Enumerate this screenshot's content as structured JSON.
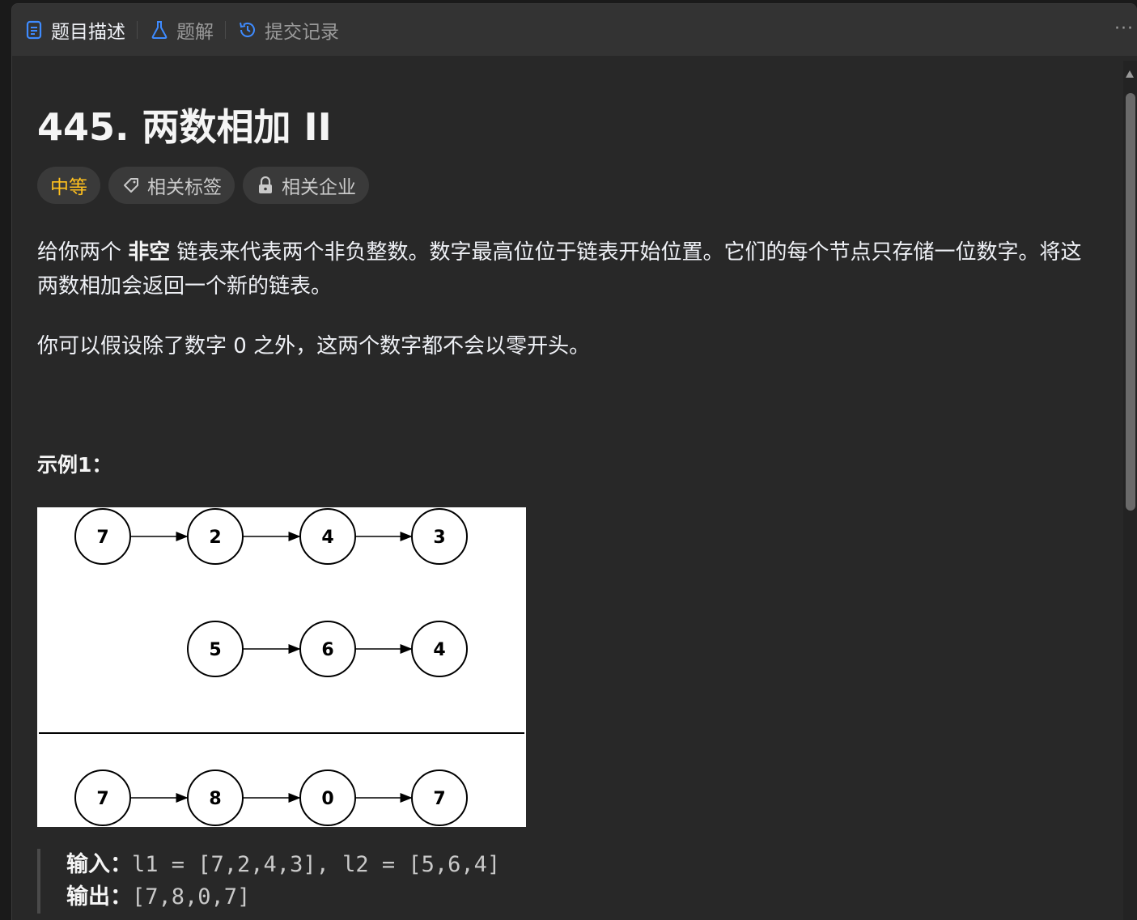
{
  "tabs": [
    {
      "label": "题目描述",
      "icon": "document-icon",
      "active": true
    },
    {
      "label": "题解",
      "icon": "flask-icon",
      "active": false
    },
    {
      "label": "提交记录",
      "icon": "history-icon",
      "active": false
    }
  ],
  "more_label": "···",
  "problem": {
    "title": "445. 两数相加 II",
    "tags": {
      "difficulty": "中等",
      "related_tags": "相关标签",
      "related_companies": "相关企业"
    },
    "desc1_pre": "给你两个 ",
    "desc1_em": "非空",
    "desc1_post": " 链表来代表两个非负整数。数字最高位位于链表开始位置。它们的每个节点只存储一位数字。将这两数相加会返回一个新的链表。",
    "desc2": "你可以假设除了数字 0 之外，这两个数字都不会以零开头。",
    "example_title": "示例1：",
    "figure": {
      "row1": [
        "7",
        "2",
        "4",
        "3"
      ],
      "row2": [
        "5",
        "6",
        "4"
      ],
      "row3": [
        "7",
        "8",
        "0",
        "7"
      ]
    },
    "io": {
      "input_label": "输入：",
      "input_value": "l1 = [7,2,4,3], l2 = [5,6,4]",
      "output_label": "输出：",
      "output_value": "[7,8,0,7]"
    }
  },
  "colors": {
    "difficulty_medium": "#ffc01e",
    "tab_icon_active": "#3e8bff",
    "tab_icon_flask": "#3e8bff"
  }
}
